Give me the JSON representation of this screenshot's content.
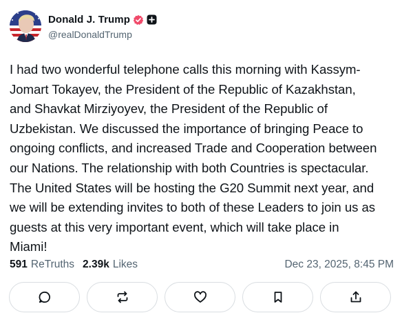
{
  "author": {
    "display_name": "Donald J. Trump",
    "handle": "@realDonaldTrump"
  },
  "post": {
    "text": "I had two wonderful telephone calls this morning with Kassym-\nJomart Tokayev, the President of the Republic of Kazakhstan,\nand Shavkat Mirziyoyev, the President of the Republic of\nUzbekistan. We discussed the importance of bringing Peace to\nongoing conflicts, and increased Trade and Cooperation between\nour Nations. The relationship with both Countries is spectacular.\nThe United States will be hosting the G20 Summit next year, and\nwe will be extending invites to both of these Leaders to join us as\nguests at this very important event, which will take place in\nMiami!",
    "retruths_count": "591",
    "retruths_label": "ReTruths",
    "likes_count": "2.39k",
    "likes_label": "Likes",
    "timestamp": "Dec 23, 2025, 8:45 PM"
  },
  "icons": {
    "verified": "verified-badge-icon",
    "plus": "plus-badge-icon",
    "reply": "reply-icon",
    "retruth": "retruth-icon",
    "like": "heart-icon",
    "bookmark": "bookmark-icon",
    "share": "share-icon"
  },
  "colors": {
    "verified": "#f04a6a",
    "text": "#0f1419",
    "muted": "#536471",
    "border": "#d9dde1"
  }
}
